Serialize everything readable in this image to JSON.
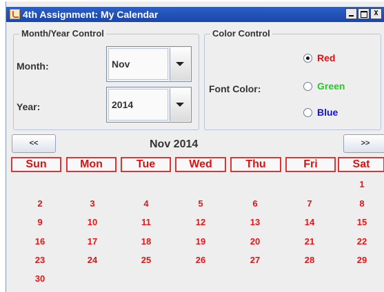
{
  "window": {
    "title": "4th Assignment: My Calendar",
    "controls": {
      "min": "",
      "max": "",
      "close": "X"
    }
  },
  "month_year_control": {
    "group_title": "Month/Year Control",
    "month_label": "Month:",
    "month_value": "Nov",
    "year_label": "Year:",
    "year_value": "2014"
  },
  "color_control": {
    "group_title": "Color Control",
    "font_color_label": "Font Color:",
    "options": [
      {
        "label": "Red",
        "color": "#e01010",
        "selected": true
      },
      {
        "label": "Green",
        "color": "#22cc22",
        "selected": false
      },
      {
        "label": "Blue",
        "color": "#1010e0",
        "selected": false
      }
    ]
  },
  "calendar": {
    "prev_label": "<<",
    "next_label": ">>",
    "title": "Nov 2014",
    "text_color": "#e01010",
    "day_headers": [
      "Sun",
      "Mon",
      "Tue",
      "Wed",
      "Thu",
      "Fri",
      "Sat"
    ],
    "weeks": [
      [
        "",
        "",
        "",
        "",
        "",
        "",
        "1"
      ],
      [
        "2",
        "3",
        "4",
        "5",
        "6",
        "7",
        "8"
      ],
      [
        "9",
        "10",
        "11",
        "12",
        "13",
        "14",
        "15"
      ],
      [
        "16",
        "17",
        "18",
        "19",
        "20",
        "21",
        "22"
      ],
      [
        "23",
        "24",
        "25",
        "26",
        "27",
        "28",
        "29"
      ],
      [
        "30",
        "",
        "",
        "",
        "",
        "",
        ""
      ]
    ]
  }
}
